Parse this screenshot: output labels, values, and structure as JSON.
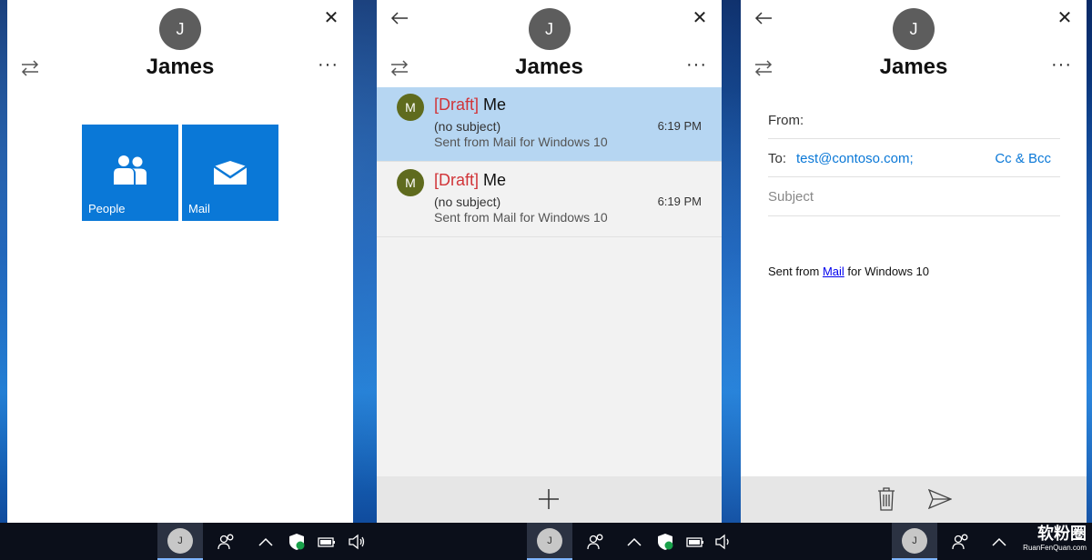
{
  "contact": {
    "name": "James",
    "initial": "J"
  },
  "panel1": {
    "tiles": [
      {
        "label": "People"
      },
      {
        "label": "Mail"
      }
    ]
  },
  "panel2": {
    "messages": [
      {
        "avatar": "M",
        "draft_tag": "[Draft]",
        "sender": "Me",
        "subject": "(no subject)",
        "time": "6:19 PM",
        "preview": "Sent from Mail for Windows 10"
      },
      {
        "avatar": "M",
        "draft_tag": "[Draft]",
        "sender": "Me",
        "subject": "(no subject)",
        "time": "6:19 PM",
        "preview": "Sent from Mail for Windows 10"
      }
    ]
  },
  "panel3": {
    "from_label": "From:",
    "to_label": "To:",
    "to_value": "test@contoso.com;",
    "cc_bcc": "Cc & Bcc",
    "subject_placeholder": "Subject",
    "body_prefix": "Sent from ",
    "body_link": "Mail",
    "body_suffix": " for Windows 10"
  },
  "taskbar": {
    "avatar": "J"
  },
  "watermark": {
    "main": "软粉圈",
    "sub": "RuanFenQuan.com"
  },
  "colors": {
    "accent": "#0a78d7",
    "draft": "#d13438",
    "selected": "#b6d6f2",
    "avatar_gray": "#5d5d5d",
    "avatar_olive": "#5f6b1e"
  },
  "icons": [
    "swap-icon",
    "close-icon",
    "back-icon",
    "more-icon",
    "people-icon",
    "mail-icon",
    "plus-icon",
    "trash-icon",
    "send-icon",
    "people-taskbar-icon",
    "chevron-up-icon",
    "defender-icon",
    "battery-icon",
    "volume-icon"
  ]
}
